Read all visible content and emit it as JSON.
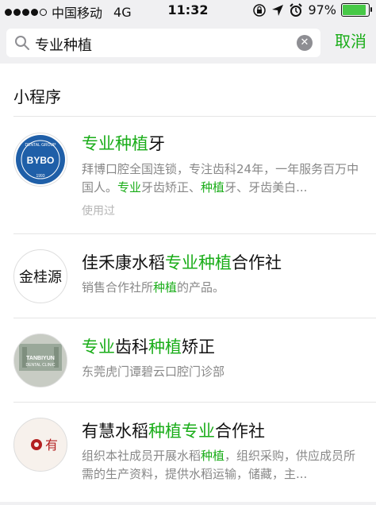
{
  "status_bar": {
    "carrier": "中国移动",
    "network": "4G",
    "time": "11:32",
    "battery_percent": "97%",
    "battery_level": 0.97,
    "signal_dots": 5,
    "signal_filled": 4
  },
  "search": {
    "query": "专业种植",
    "clear_icon": "clear-icon",
    "cancel_label": "取消"
  },
  "section": {
    "title": "小程序"
  },
  "results": [
    {
      "title": [
        {
          "t": "专业种植",
          "hl": true
        },
        {
          "t": "牙",
          "hl": false
        }
      ],
      "desc": [
        {
          "t": "拜博口腔全国连锁，专注齿科24年，一年服务百万中国人。",
          "hl": false
        },
        {
          "t": "专业",
          "hl": true
        },
        {
          "t": "牙齿矫正、",
          "hl": false
        },
        {
          "t": "种植",
          "hl": true
        },
        {
          "t": "牙、牙齿美白...",
          "hl": false
        }
      ],
      "meta": "使用过",
      "logo": {
        "line1": "DENTAL GROUP",
        "line2": "BYBO",
        "line3": "1993"
      }
    },
    {
      "title": [
        {
          "t": "佳禾康水稻",
          "hl": false
        },
        {
          "t": "专业种植",
          "hl": true
        },
        {
          "t": "合作社",
          "hl": false
        }
      ],
      "desc": [
        {
          "t": "销售合作社所",
          "hl": false
        },
        {
          "t": "种植",
          "hl": true
        },
        {
          "t": "的产品。",
          "hl": false
        }
      ],
      "logo": {
        "text": "金桂源"
      }
    },
    {
      "title": [
        {
          "t": "专业",
          "hl": true
        },
        {
          "t": "齿科",
          "hl": false
        },
        {
          "t": "种植",
          "hl": true
        },
        {
          "t": "矫正",
          "hl": false
        }
      ],
      "desc": [
        {
          "t": "东莞虎门谭碧云口腔门诊部",
          "hl": false
        }
      ],
      "logo": {
        "line1": "TANBIYUN",
        "line2": "DENTAL CLINIC"
      }
    },
    {
      "title": [
        {
          "t": "有慧水稻",
          "hl": false
        },
        {
          "t": "种植专业",
          "hl": true
        },
        {
          "t": "合作社",
          "hl": false
        }
      ],
      "desc": [
        {
          "t": "组织本社成员开展水稻",
          "hl": false
        },
        {
          "t": "种植",
          "hl": true
        },
        {
          "t": "，组织采购，供应成员所需的生产资料，提供水稻运输，储藏，主...",
          "hl": false
        }
      ],
      "logo": {
        "text": "有"
      }
    }
  ]
}
